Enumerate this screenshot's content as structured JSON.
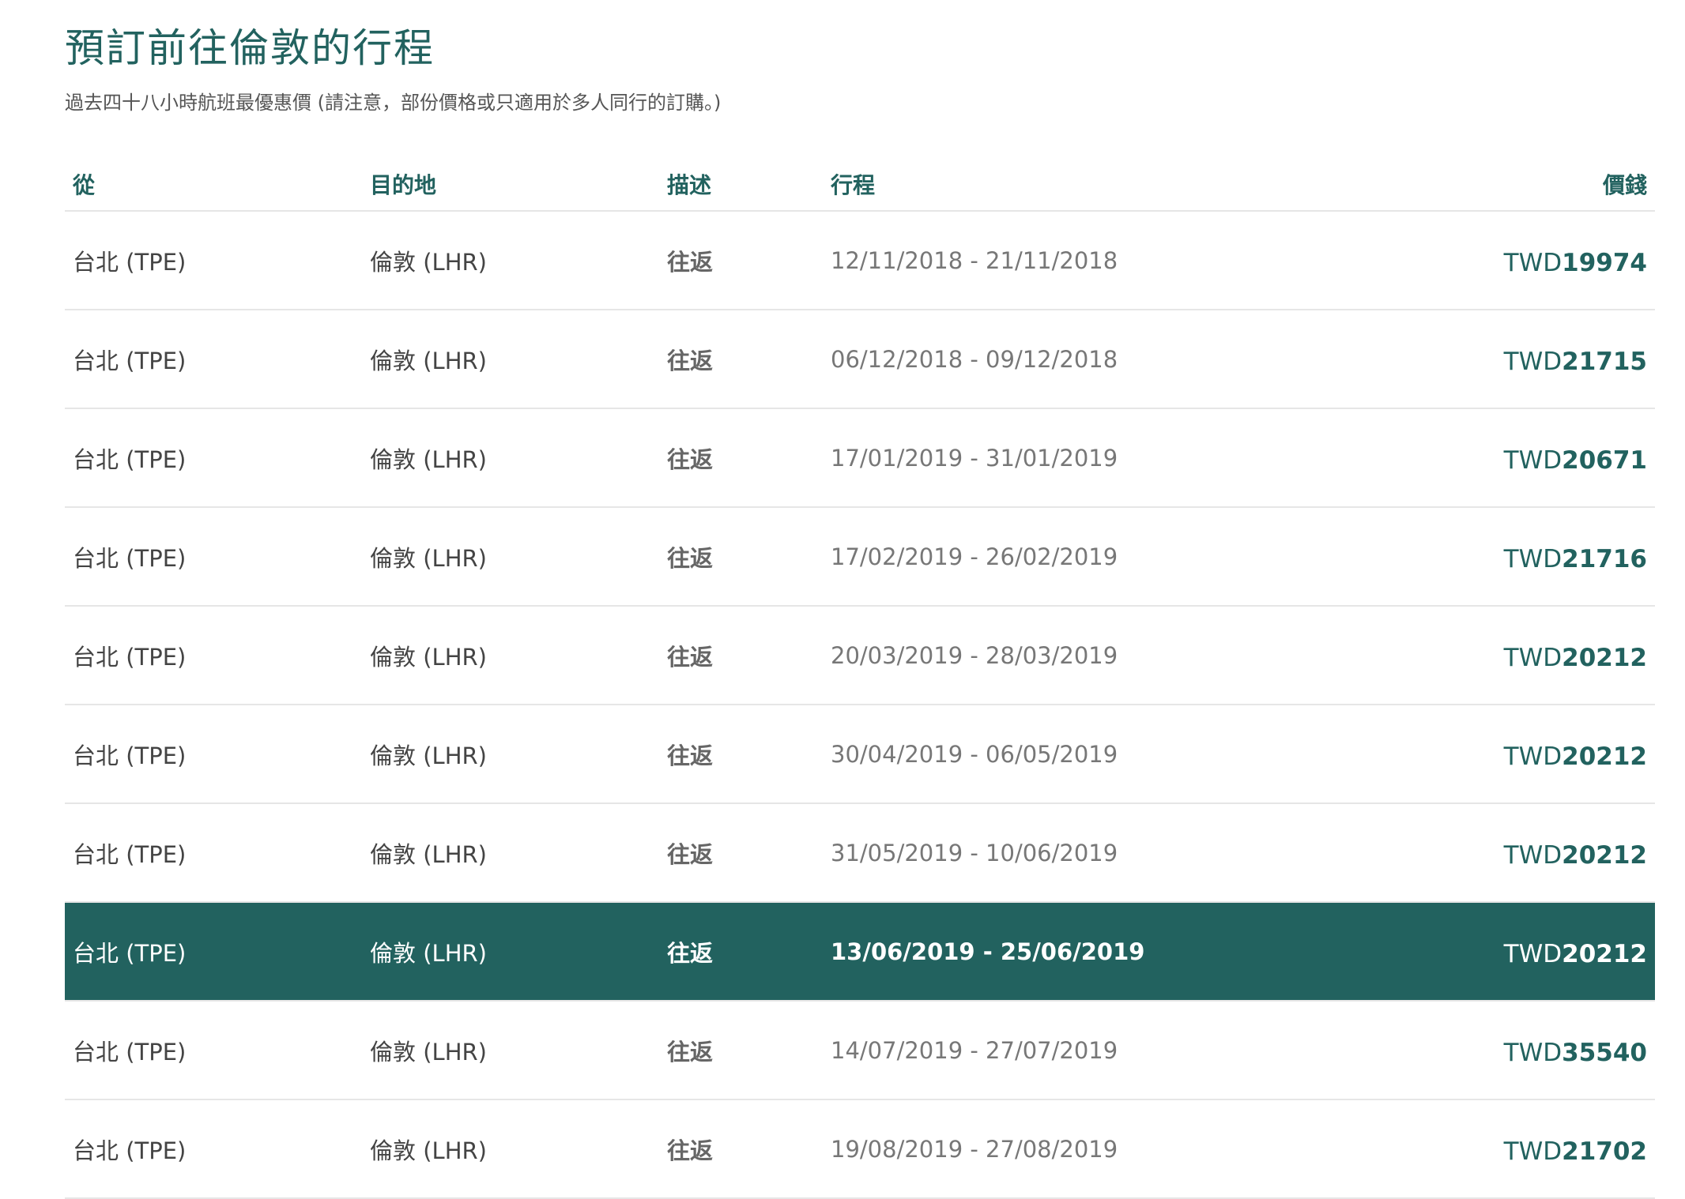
{
  "page": {
    "title": "預訂前往倫敦的行程",
    "subtitle": "過去四十八小時航班最優惠價 (請注意，部份價格或只適用於多人同行的訂購。)"
  },
  "colors": {
    "accent": "#22625f",
    "text": "#444444",
    "divider": "#e6e6e6",
    "highlight_row_bg": "#22625f"
  },
  "table": {
    "headers": {
      "from": "從",
      "destination": "目的地",
      "description": "描述",
      "itinerary": "行程",
      "price": "價錢"
    },
    "highlighted_row_index": 7,
    "rows": [
      {
        "from": "台北 (TPE)",
        "destination": "倫敦 (LHR)",
        "description": "往返",
        "itinerary": "12/11/2018 - 21/11/2018",
        "currency": "TWD",
        "amount": "19974"
      },
      {
        "from": "台北 (TPE)",
        "destination": "倫敦 (LHR)",
        "description": "往返",
        "itinerary": "06/12/2018 - 09/12/2018",
        "currency": "TWD",
        "amount": "21715"
      },
      {
        "from": "台北 (TPE)",
        "destination": "倫敦 (LHR)",
        "description": "往返",
        "itinerary": "17/01/2019 - 31/01/2019",
        "currency": "TWD",
        "amount": "20671"
      },
      {
        "from": "台北 (TPE)",
        "destination": "倫敦 (LHR)",
        "description": "往返",
        "itinerary": "17/02/2019 - 26/02/2019",
        "currency": "TWD",
        "amount": "21716"
      },
      {
        "from": "台北 (TPE)",
        "destination": "倫敦 (LHR)",
        "description": "往返",
        "itinerary": "20/03/2019 - 28/03/2019",
        "currency": "TWD",
        "amount": "20212"
      },
      {
        "from": "台北 (TPE)",
        "destination": "倫敦 (LHR)",
        "description": "往返",
        "itinerary": "30/04/2019 - 06/05/2019",
        "currency": "TWD",
        "amount": "20212"
      },
      {
        "from": "台北 (TPE)",
        "destination": "倫敦 (LHR)",
        "description": "往返",
        "itinerary": "31/05/2019 - 10/06/2019",
        "currency": "TWD",
        "amount": "20212"
      },
      {
        "from": "台北 (TPE)",
        "destination": "倫敦 (LHR)",
        "description": "往返",
        "itinerary": "13/06/2019 - 25/06/2019",
        "currency": "TWD",
        "amount": "20212"
      },
      {
        "from": "台北 (TPE)",
        "destination": "倫敦 (LHR)",
        "description": "往返",
        "itinerary": "14/07/2019 - 27/07/2019",
        "currency": "TWD",
        "amount": "35540"
      },
      {
        "from": "台北 (TPE)",
        "destination": "倫敦 (LHR)",
        "description": "往返",
        "itinerary": "19/08/2019 - 27/08/2019",
        "currency": "TWD",
        "amount": "21702"
      }
    ]
  }
}
